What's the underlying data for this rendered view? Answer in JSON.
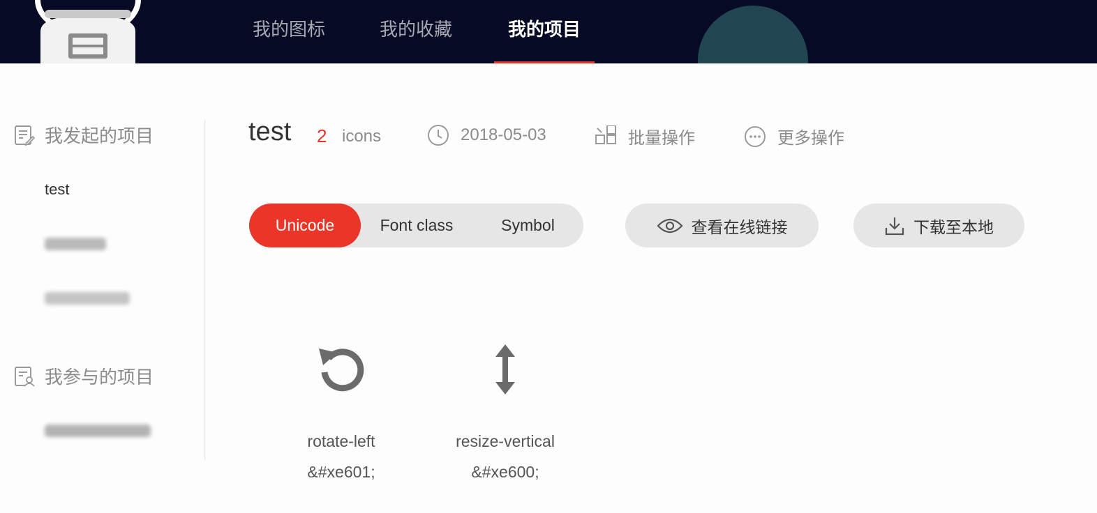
{
  "nav": {
    "tabs": [
      {
        "label": "我的图标"
      },
      {
        "label": "我的收藏"
      },
      {
        "label": "我的项目"
      }
    ],
    "active_index": 2
  },
  "sidebar": {
    "owned_title": "我发起的项目",
    "owned_items": [
      {
        "label": "test"
      }
    ],
    "joined_title": "我参与的项目"
  },
  "project": {
    "title": "test",
    "icon_count": "2",
    "icon_count_label": "icons",
    "date": "2018-05-03",
    "batch_label": "批量操作",
    "more_label": "更多操作"
  },
  "tabs": {
    "unicode": "Unicode",
    "font_class": "Font class",
    "symbol": "Symbol",
    "active": "Unicode"
  },
  "actions": {
    "view_online": "查看在线链接",
    "download": "下载至本地"
  },
  "icons": [
    {
      "name": "rotate-left",
      "code": "&#xe601;",
      "glyph": "rotate-left-icon"
    },
    {
      "name": "resize-vertical",
      "code": "&#xe600;",
      "glyph": "resize-vertical-icon"
    }
  ],
  "colors": {
    "accent": "#e93628",
    "nav_bg": "#070a24"
  }
}
